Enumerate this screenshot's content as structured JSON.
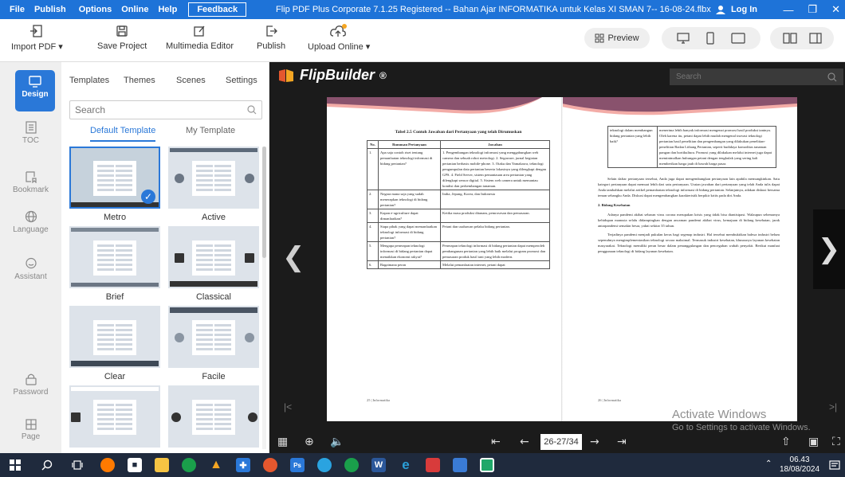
{
  "titlebar": {
    "menu": [
      "File",
      "Publish",
      "Options",
      "Online",
      "Help"
    ],
    "feedback": "Feedback",
    "title": "Flip PDF Plus Corporate 7.1.25 Registered -- Bahan Ajar INFORMATIKA untuk Kelas XI SMAN 7-- 16-08-24.flbx",
    "login": "Log In",
    "accent": "#1e73d8"
  },
  "toolbar": {
    "import": "Import PDF",
    "save": "Save Project",
    "multimedia": "Multimedia Editor",
    "publish": "Publish",
    "upload": "Upload Online",
    "preview": "Preview"
  },
  "sidebar": {
    "items": [
      {
        "label": "Design",
        "icon": "monitor-icon"
      },
      {
        "label": "TOC",
        "icon": "list-icon"
      },
      {
        "label": "Bookmark",
        "icon": "bookmark-icon"
      },
      {
        "label": "Language",
        "icon": "globe-icon"
      },
      {
        "label": "Assistant",
        "icon": "chat-icon"
      },
      {
        "label": "Password",
        "icon": "lock-icon"
      },
      {
        "label": "Page",
        "icon": "page-grid-icon"
      }
    ]
  },
  "panel": {
    "tabs": [
      "Templates",
      "Themes",
      "Scenes",
      "Settings"
    ],
    "search_placeholder": "Search",
    "sub_tabs": [
      "Default Template",
      "My Template"
    ],
    "templates": [
      "Metro",
      "Active",
      "Brief",
      "Classical",
      "Clear",
      "Facile",
      "",
      ""
    ]
  },
  "viewer": {
    "brand": "FlipBuilder",
    "brand_mark": "®",
    "search_placeholder": "Search",
    "page_indicator": "26-27/34",
    "activate_title": "Activate Windows",
    "activate_sub": "Go to Settings to activate Windows."
  },
  "book": {
    "left_title": "Tabel 2.5 Contoh Jawaban dari Pertanyaan yang telah Dirumuskan",
    "col_no": "No.",
    "col_q": "Rumusan Pertanyaan",
    "col_a": "Jawaban",
    "rows": [
      {
        "no": "1.",
        "q": "Apa saja contoh riset tentang pemanfaatan teknologi informasi di bidang pertanian?",
        "a": "1. Pengembangan teknologi informasi yang menggabungkan web camera dan sebuah robot metrologi. 2. Segaware, jurnal kegiatan pertanian berbasis mobile-phone. 3. Otaku dan Yamakawa, teknologi pengumpulan data pertanian beserta lokasinya yang dilengkapi dengan GPS. 4. Field Server, sistem pemantauan area pertanian yang dilengkapi sensor digital. 5. Sistem web camera untuk memantau kondisi dan perkembangan tanaman."
      },
      {
        "no": "2.",
        "q": "Negara mana saja yang sudah menerapkan teknologi di bidang pertanian?",
        "a": "India, Jepang, Korea, dan Indonesia"
      },
      {
        "no": "3.",
        "q": "Kapan e-agriculture dapat dimanfaatkan?",
        "a": "Ketika masa produksi ditanam, pemrosesan dan pemasaran."
      },
      {
        "no": "4.",
        "q": "Siapa pihak yang dapat memanfaatkan teknologi informasi di bidang pertanian?",
        "a": "Petani dan usahawan pelaku bidang pertanian."
      },
      {
        "no": "5.",
        "q": "Mengapa penerapan teknologi informasi di bidang pertanian dapat menaikkan ekonomi rakyat?",
        "a": "Penerapan teknologi informasi di bidang pertanian dapat memperoleh pembangunan pertanian yang lebih baik melalui program promosi dan pemasaran produk hasil tani yang lebih modern."
      },
      {
        "no": "6.",
        "q": "Bagaimana peran",
        "a": "Melalui pemanfaatan internet, petani dapat"
      }
    ],
    "left_footer": "25 | Informatika",
    "right_cont_q": "teknologi dalam membangun bidang pertanian yang lebih baik?",
    "right_cont_a": "menerima lebih banyak informasi mengenai promosi hasil produksi taninya. Oleh karena itu, petani dapat lebih mudah mengenal inovasi teknologi pertanian hasil penelitian dan pengembangan yang dilakukan penelitian-penelitian Badan Litbang Pertanian, seperti budidaya komoditas tanaman pangan dan hortikultura. Promosi yang dilakukan melalui internet juga dapat meminimalkan hubungan petani dengan tengkulak yang sering kali memberikan harga jauh di bawah harga pasar.",
    "right_p1": "Selain daftar pertanyaan tersebut, Anda juga dapat mengembangkan pertanyaan lain apabila memungkinkan. Satu kategori pertanyaan dapat memuat lebih dari satu pertanyaan. Uraian jawaban dari pertanyaan yang telah Anda tulis dapat Anda tambahkan melalui artikel pemanfaatan teknologi informasi di bidang pertanian. Selanjutnya, adakan diskusi bersama teman sebangku Anda. Diskusi dapat mengembangkan karakteristik berpikir kritis pada diri Anda.",
    "right_heading": "2. Bidang Kesehatan",
    "right_p2": "Adanya pandemi akibat sebaran virus corona merupakan krisis yang tidak bisa diantisipasi. Walaupun sebenarnya kehidupan manusia selalu didampingkan dengan ancaman pandemi akibat virus, kemajuan di bidang kesehatan, jarak antarpandemi semakin besar, yakni sekitar 35 tahun.",
    "right_p3": "Terjadinya pandemi menjadi pukulan keras bagi segenap industri. Hal tersebut membuktikan bahwa industri belum sepenuhnya mengimplementasikan teknologi secara maksimal. Termasuk industri kesehatan, khususnya layanan kesehatan masyarakat. Teknologi memiliki peran besar dalam penanggulangan dan pencegahan wabah penyakit. Berikut manfaat penggunaan teknologi di bidang layanan kesehatan.",
    "right_footer": "26 | Informatika"
  },
  "taskbar": {
    "time": "06.43",
    "date": "18/08/2024"
  }
}
